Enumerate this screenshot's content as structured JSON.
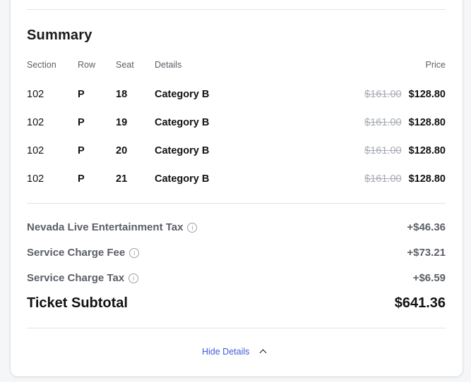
{
  "summary": {
    "title": "Summary",
    "headers": {
      "section": "Section",
      "row": "Row",
      "seat": "Seat",
      "details": "Details",
      "price": "Price"
    },
    "tickets": [
      {
        "section": "102",
        "row": "P",
        "seat": "18",
        "details": "Category B",
        "original_price": "$161.00",
        "price": "$128.80"
      },
      {
        "section": "102",
        "row": "P",
        "seat": "19",
        "details": "Category B",
        "original_price": "$161.00",
        "price": "$128.80"
      },
      {
        "section": "102",
        "row": "P",
        "seat": "20",
        "details": "Category B",
        "original_price": "$161.00",
        "price": "$128.80"
      },
      {
        "section": "102",
        "row": "P",
        "seat": "21",
        "details": "Category B",
        "original_price": "$161.00",
        "price": "$128.80"
      }
    ]
  },
  "fees": [
    {
      "label": "Nevada Live Entertainment Tax",
      "value": "+$46.36",
      "info_icon": "info-circle-icon"
    },
    {
      "label": "Service Charge Fee",
      "value": "+$73.21",
      "info_icon": "info-circle-icon"
    },
    {
      "label": "Service Charge Tax",
      "value": "+$6.59",
      "info_icon": "info-circle-icon"
    }
  ],
  "subtotal": {
    "label": "Ticket Subtotal",
    "value": "$641.36"
  },
  "toggle": {
    "label": "Hide Details",
    "icon": "chevron-up-icon"
  },
  "colors": {
    "link": "#3b5bdb",
    "strikethrough": "#a7abb3",
    "muted_text": "#5b5f66"
  }
}
